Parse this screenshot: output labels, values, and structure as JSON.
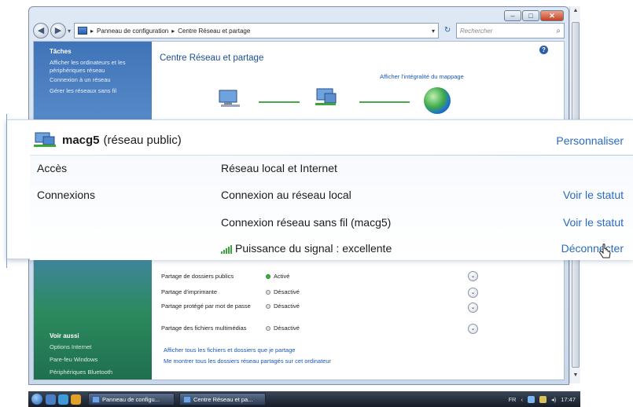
{
  "window": {
    "breadcrumb": [
      "Panneau de configuration",
      "Centre Réseau et partage"
    ],
    "search_placeholder": "Rechercher",
    "caption_buttons": [
      "minimize",
      "maximize",
      "close"
    ]
  },
  "left_pane": {
    "tasks_heading": "Tâches",
    "tasks": [
      "Afficher les ordinateurs et les périphériques réseau",
      "Connexion à un réseau",
      "Gérer les réseaux sans fil"
    ],
    "see_also_heading": "Voir aussi",
    "see_also": [
      "Options Internet",
      "Pare-feu Windows",
      "Périphériques Bluetooth"
    ]
  },
  "main": {
    "title": "Centre Réseau et partage",
    "map_link": "Afficher l'intégralité du mappage",
    "sharing": [
      {
        "label": "Partage de dossiers publics",
        "status": "Activé",
        "on": true
      },
      {
        "label": "Partage d'imprimante",
        "status": "Désactivé",
        "on": false
      },
      {
        "label": "Partage protégé par mot de passe",
        "status": "Désactivé",
        "on": false
      },
      {
        "label": "Partage des fichiers multimédias",
        "status": "Désactivé",
        "on": false
      }
    ],
    "bottom_links": [
      "Afficher tous les fichiers et dossiers que je partage",
      "Me montrer tous les dossiers réseau partagés sur cet ordinateur"
    ]
  },
  "callout": {
    "network_name": "macg5",
    "network_type": "(réseau public)",
    "customize_link": "Personnaliser",
    "rows": {
      "access_label": "Accès",
      "access_value": "Réseau local et Internet",
      "connections_label": "Connexions",
      "conn1": "Connexion au réseau local",
      "conn1_link": "Voir le statut",
      "conn2": "Connexion réseau sans fil (macg5)",
      "conn2_link": "Voir le statut",
      "signal": "Puissance du signal : excellente",
      "disconnect_link": "Déconnecter"
    }
  },
  "taskbar": {
    "tasks": [
      "Panneau de configu...",
      "Centre Réseau et pa..."
    ],
    "language": "FR",
    "clock": "17:47"
  },
  "colors": {
    "link": "#2a6bbd",
    "title_blue": "#1d4f93",
    "signal_green": "#3aa63a"
  }
}
